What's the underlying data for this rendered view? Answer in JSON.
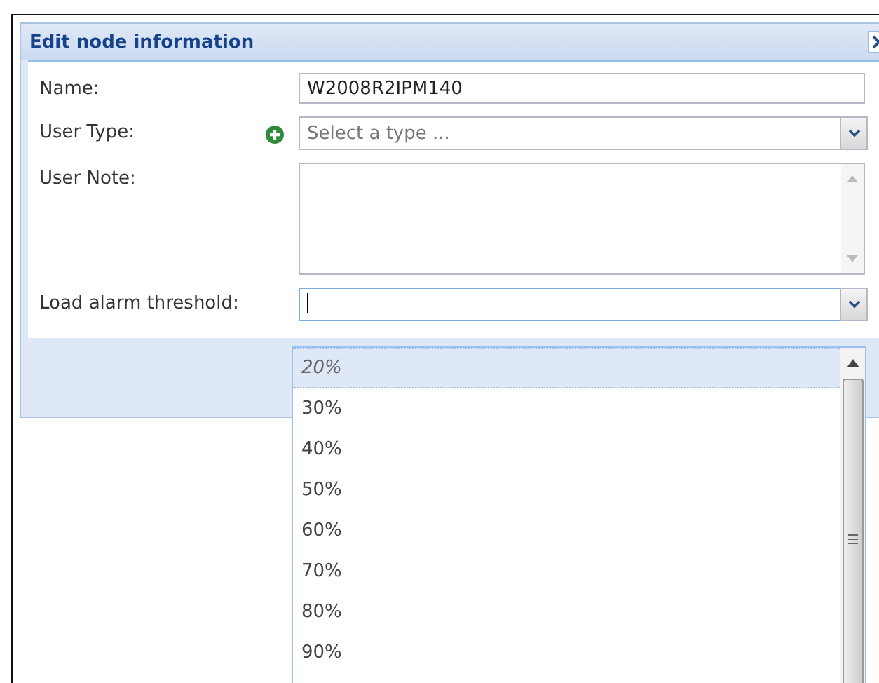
{
  "window": {
    "title": "Edit node information"
  },
  "fields": [
    {
      "kind": "text",
      "label": "Name:",
      "value": "W2008R2IPM140"
    },
    {
      "kind": "combo",
      "label": "User Type:",
      "placeholder": "Select a type ...",
      "add_button": true
    },
    {
      "kind": "textarea",
      "label": "User Note:"
    },
    {
      "kind": "combo",
      "label": "Load alarm threshold:",
      "focused": true
    }
  ],
  "dropdown": {
    "options": [
      {
        "label": "20%",
        "selected": true
      },
      {
        "label": "30%",
        "selected": false
      },
      {
        "label": "40%",
        "selected": false
      },
      {
        "label": "50%",
        "selected": false
      },
      {
        "label": "60%",
        "selected": false
      },
      {
        "label": "70%",
        "selected": false
      },
      {
        "label": "80%",
        "selected": false
      },
      {
        "label": "90%",
        "selected": false
      }
    ]
  }
}
